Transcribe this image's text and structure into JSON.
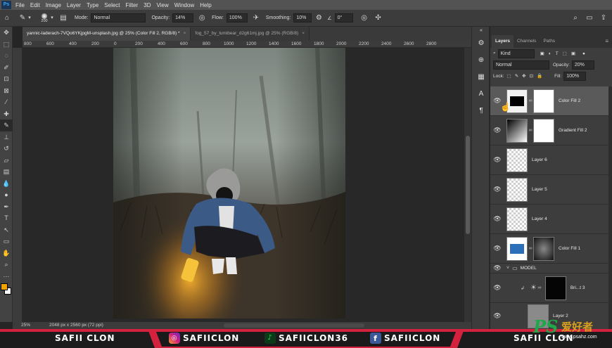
{
  "menubar": {
    "logo": "Ps",
    "items": [
      "File",
      "Edit",
      "Image",
      "Layer",
      "Type",
      "Select",
      "Filter",
      "3D",
      "View",
      "Window",
      "Help"
    ]
  },
  "options": {
    "brush_size": "200",
    "mode_label": "Mode:",
    "mode_value": "Normal",
    "opacity_label": "Opacity:",
    "opacity_value": "14%",
    "flow_label": "Flow:",
    "flow_value": "100%",
    "smoothing_label": "Smoothing:",
    "smoothing_value": "10%",
    "angle_label": "∠",
    "angle_value": "0°"
  },
  "tabs": [
    {
      "label": "yannic-laderach-7VQo6YKjpgM-unsplash.jpg @ 25% (Color Fill 2, RGB/8) *",
      "close": "×"
    },
    {
      "label": "fog_57_by_lumibear_d2g61mj.jpg @ 25% (RGB/8)",
      "close": "×"
    }
  ],
  "ruler_ticks": [
    "800",
    "600",
    "400",
    "200",
    "0",
    "200",
    "400",
    "600",
    "800",
    "1000",
    "1200",
    "1400",
    "1600",
    "1800",
    "2000",
    "2200",
    "2400",
    "2600",
    "2800"
  ],
  "status": {
    "zoom": "25%",
    "doc_info": "2048 px x 2560 px (72 ppi)"
  },
  "layers_panel": {
    "tabs": [
      "Layers",
      "Channels",
      "Paths"
    ],
    "kind_label": "Kind",
    "blend_mode": "Normal",
    "opacity_label": "Opacity:",
    "opacity_value": "20%",
    "lock_label": "Lock:",
    "fill_label": "Fill:",
    "fill_value": "100%",
    "layers": [
      {
        "name": "Color Fill 2"
      },
      {
        "name": "Gradient Fill 2"
      },
      {
        "name": "Layer 6"
      },
      {
        "name": "Layer 5"
      },
      {
        "name": "Layer 4"
      },
      {
        "name": "Color Fill 1"
      },
      {
        "name": "MODEL"
      },
      {
        "name": "Bri...t 3"
      },
      {
        "name": "Layer 2"
      }
    ]
  },
  "banner": {
    "left": "SAFII CLON",
    "instagram": "SAFIICLON",
    "tiktok": "SAFIICLON36",
    "facebook": "SAFIICLON",
    "right": "SAFII CLON"
  },
  "watermark": {
    "ps": "PS",
    "cn": "爱好者",
    "url": "www.psahz.com"
  },
  "colors": {
    "accent": "#31a8ff",
    "banner_red": "#d4213d",
    "foreground": "#f2a400",
    "background": "#ffffff",
    "color_fill_1": "#2a6fb8"
  }
}
